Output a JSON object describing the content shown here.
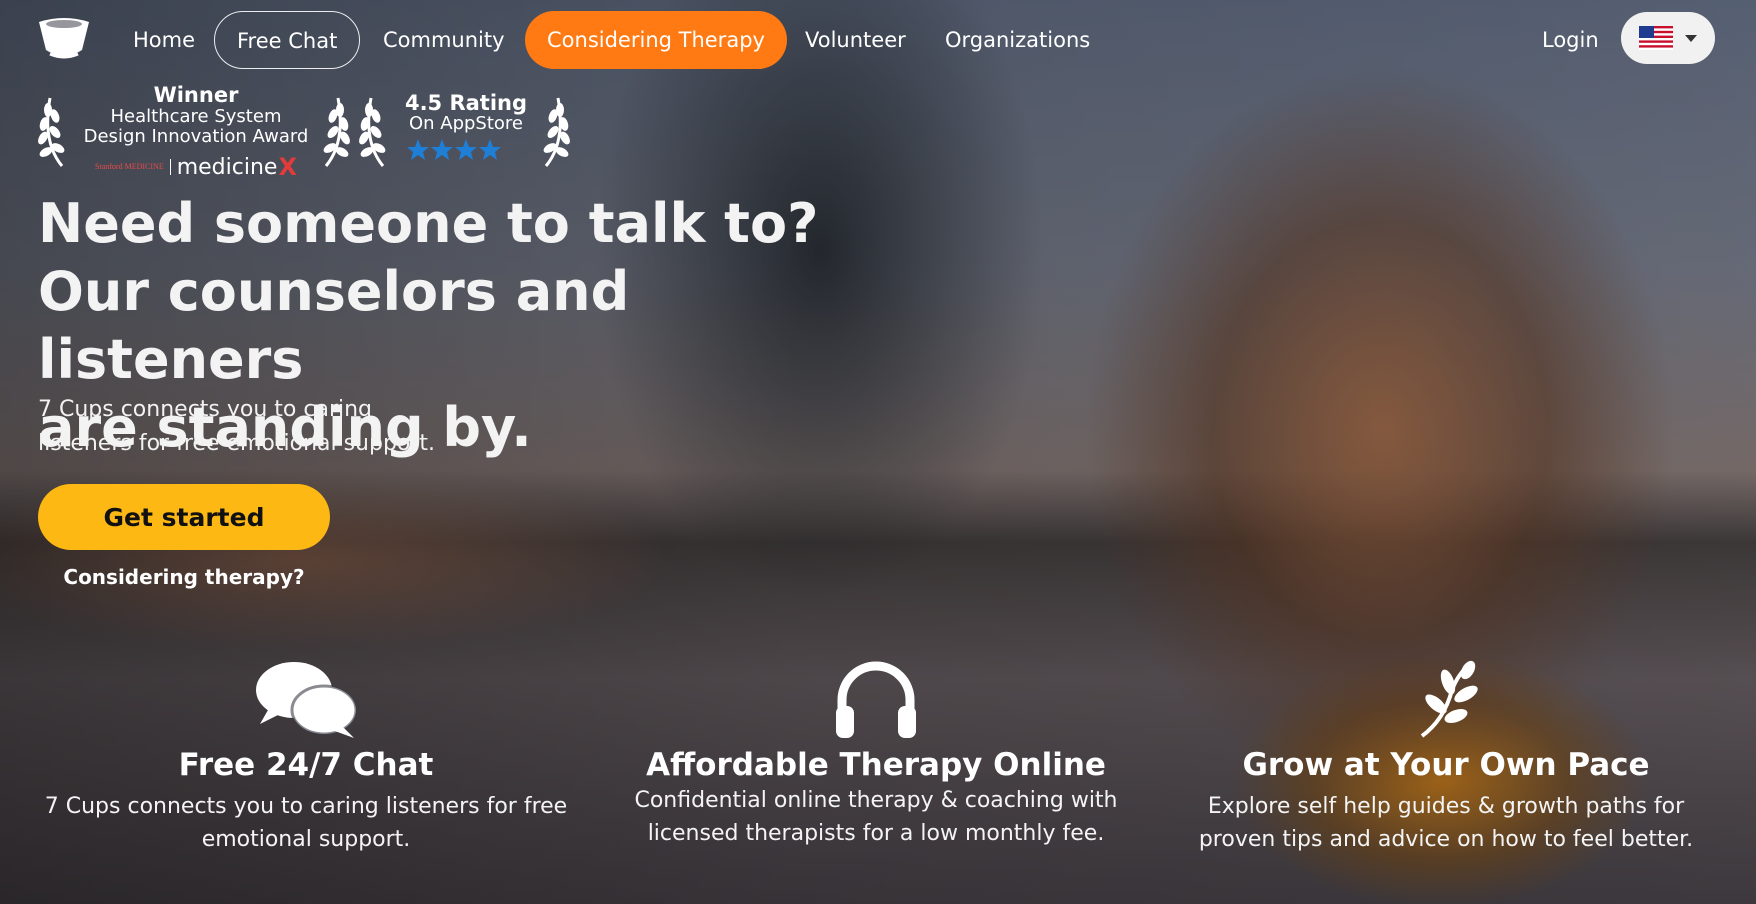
{
  "nav": {
    "items": [
      {
        "label": "Home"
      },
      {
        "label": "Free Chat"
      },
      {
        "label": "Community"
      },
      {
        "label": "Considering Therapy"
      },
      {
        "label": "Volunteer"
      },
      {
        "label": "Organizations"
      }
    ],
    "login": "Login",
    "language": "en-US",
    "accent_color": "#ff7a12"
  },
  "awards": {
    "winner": {
      "title": "Winner",
      "line1": "Healthcare System",
      "line2": "Design Innovation Award",
      "logo_stanford": "Stanford MEDICINE",
      "logo_medicine": "medicine",
      "logo_x": "X"
    },
    "rating": {
      "title": "4.5 Rating",
      "subtitle": "On AppStore",
      "stars": 4.5
    }
  },
  "hero": {
    "title_line1": "Need someone to talk to?",
    "title_line2": "Our counselors and listeners",
    "title_line3": "are standing by.",
    "subtitle_line1": "7 Cups connects you to caring",
    "subtitle_line2": "listeners for free emotional support.",
    "cta": "Get started",
    "cta_color": "#fdb813",
    "secondary_link": "Considering therapy?"
  },
  "features": [
    {
      "icon": "chat-bubbles-icon",
      "title": "Free 24/7 Chat",
      "line1": "7 Cups connects you to caring listeners for free",
      "line2": "emotional support."
    },
    {
      "icon": "headphones-icon",
      "title": "Affordable Therapy Online",
      "line1": "Confidential online therapy & coaching with",
      "line2": "licensed therapists for a low monthly fee."
    },
    {
      "icon": "sprout-icon",
      "title": "Grow at Your Own Pace",
      "line1": "Explore self help guides & growth paths for",
      "line2": "proven tips and advice on how to feel better."
    }
  ]
}
